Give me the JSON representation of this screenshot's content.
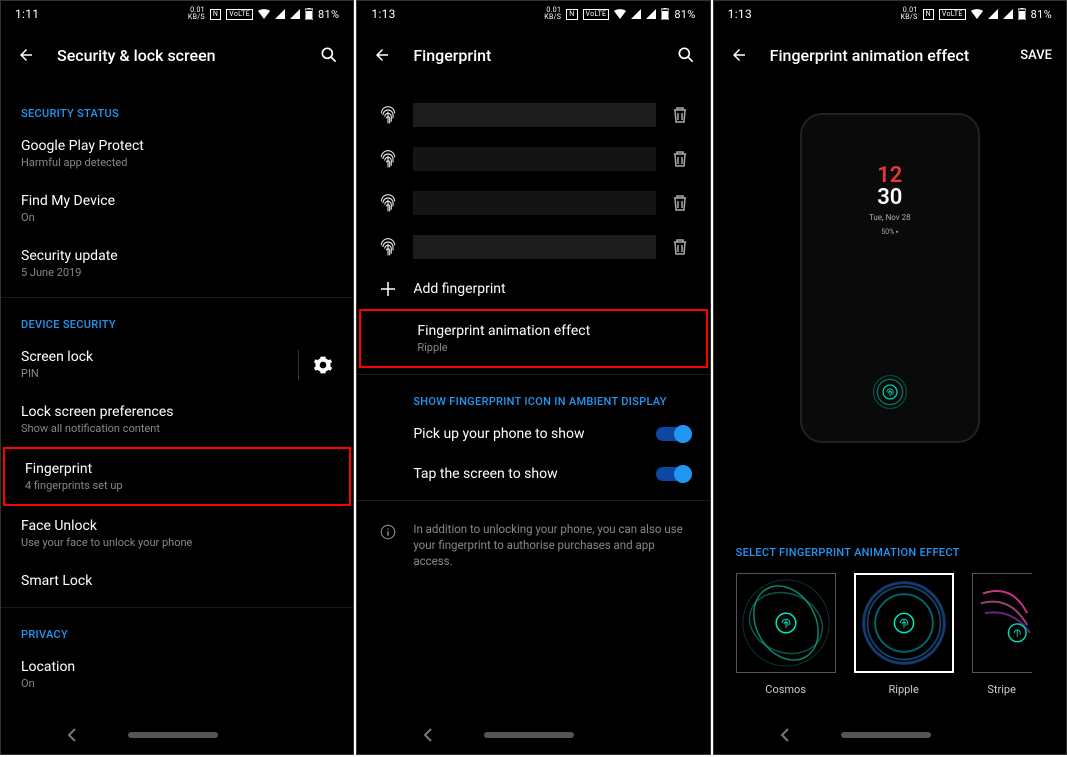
{
  "status": {
    "time1": "1:11",
    "time2": "1:13",
    "time3": "1:13",
    "kbs_top": "0.01",
    "kbs_bottom": "KB/S",
    "nfc": "N",
    "volte": "VoLTE",
    "battery": "81%"
  },
  "screen1": {
    "title": "Security & lock screen",
    "sections": {
      "security_status": "SECURITY STATUS",
      "device_security": "DEVICE SECURITY",
      "privacy": "PRIVACY"
    },
    "items": {
      "gpp_title": "Google Play Protect",
      "gpp_sub": "Harmful app detected",
      "fmd_title": "Find My Device",
      "fmd_sub": "On",
      "su_title": "Security update",
      "su_sub": "5 June 2019",
      "sl_title": "Screen lock",
      "sl_sub": "PIN",
      "lsp_title": "Lock screen preferences",
      "lsp_sub": "Show all notification content",
      "fp_title": "Fingerprint",
      "fp_sub": "4 fingerprints set up",
      "fu_title": "Face Unlock",
      "fu_sub": "Use your face to unlock your phone",
      "smart_title": "Smart Lock",
      "loc_title": "Location",
      "loc_sub": "On"
    }
  },
  "screen2": {
    "title": "Fingerprint",
    "add_fp": "Add fingerprint",
    "anim_title": "Fingerprint animation effect",
    "anim_sub": "Ripple",
    "section_ambient": "SHOW FINGERPRINT ICON IN AMBIENT DISPLAY",
    "pickup": "Pick up your phone to show",
    "tap": "Tap the screen to show",
    "info": "In addition to unlocking your phone, you can also use your fingerprint to authorise purchases and app access."
  },
  "screen3": {
    "title": "Fingerprint animation effect",
    "save": "SAVE",
    "clock_top": "12",
    "clock_bottom": "30",
    "clock_date": "Tue, Nov 28",
    "clock_batt": "50% ▪",
    "effects_label": "SELECT FINGERPRINT ANIMATION EFFECT",
    "effects": {
      "cosmos": "Cosmos",
      "ripple": "Ripple",
      "stripe": "Stripe"
    }
  }
}
